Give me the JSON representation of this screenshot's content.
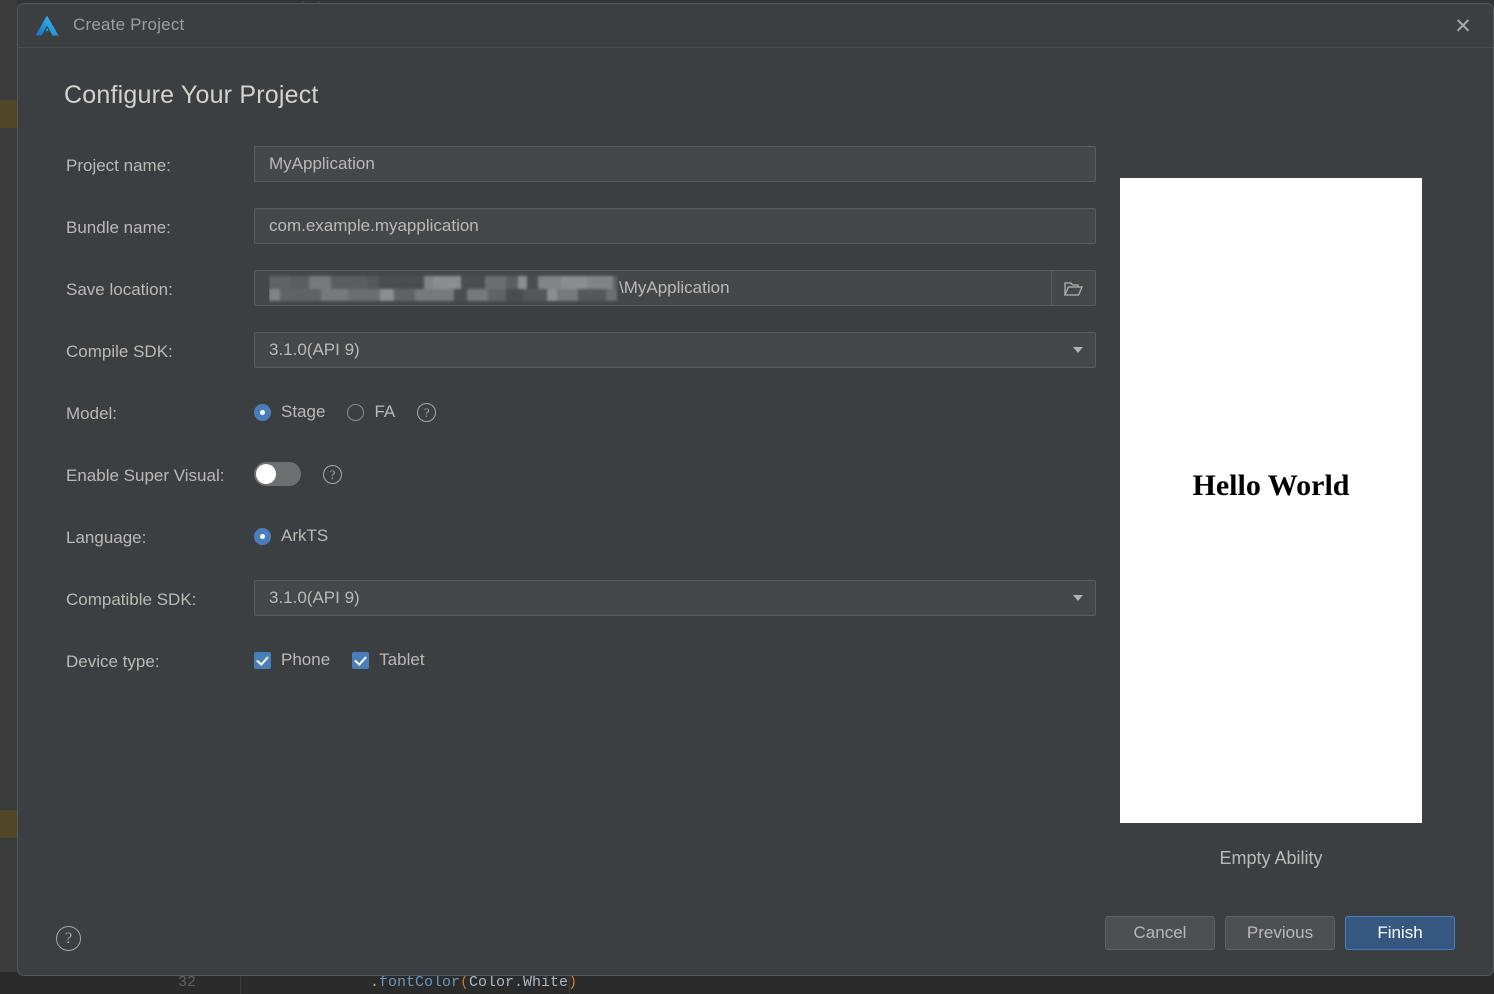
{
  "backdrop": {
    "code_line_number": "32",
    "code_snippet_dot": ".",
    "code_snippet_fn": "fontColor",
    "code_snippet_open": "(",
    "code_snippet_arg": "Color.White",
    "code_snippet_close": ")",
    "top_faint_text": "}  }"
  },
  "window": {
    "title": "Create Project",
    "logo_name": "deveco-studio-logo",
    "close_label": "✕"
  },
  "heading": "Configure Your Project",
  "form": {
    "rows": [
      {
        "label": "Project name:",
        "value": "MyApplication"
      },
      {
        "label": "Bundle name:",
        "value": "com.example.myapplication"
      },
      {
        "label": "Save location:",
        "value_redacted": true,
        "value_tail": "\\MyApplication",
        "browse_icon": "folder-icon"
      },
      {
        "label": "Compile SDK:",
        "value": "3.1.0(API 9)",
        "dropdown": true
      },
      {
        "label": "Model:",
        "options": [
          {
            "text": "Stage",
            "selected": true
          },
          {
            "text": "FA",
            "selected": false
          }
        ],
        "help": "?"
      },
      {
        "label": "Enable Super Visual:",
        "toggle_on": false,
        "help": "?"
      },
      {
        "label": "Language:",
        "options": [
          {
            "text": "ArkTS",
            "selected": true
          }
        ]
      },
      {
        "label": "Compatible SDK:",
        "value": "3.1.0(API 9)",
        "dropdown": true
      },
      {
        "label": "Device type:",
        "checkboxes": [
          {
            "text": "Phone",
            "checked": true
          },
          {
            "text": "Tablet",
            "checked": true
          }
        ]
      }
    ]
  },
  "preview": {
    "screen_text": "Hello World",
    "caption": "Empty Ability"
  },
  "footer": {
    "help_label": "?",
    "cancel_label": "Cancel",
    "previous_label": "Previous",
    "finish_label": "Finish"
  },
  "colors": {
    "dialog_bg": "#3c3f41",
    "field_bg": "#45484a",
    "accent_blue": "#4a7ebb",
    "primary_btn_bg": "#365880",
    "text": "#bcb9b3",
    "preview_bg": "#ffffff"
  }
}
